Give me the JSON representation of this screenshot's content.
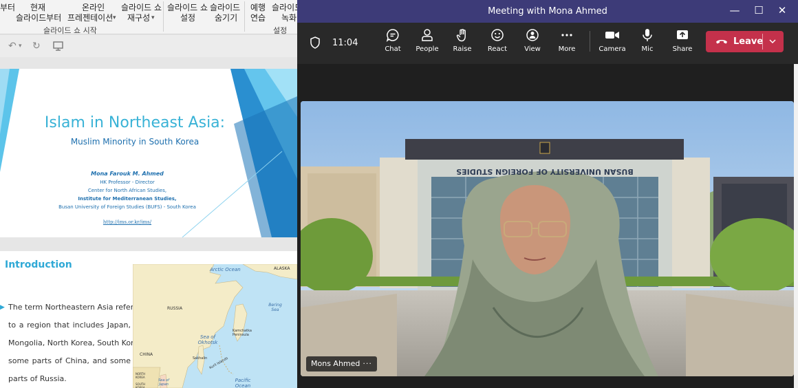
{
  "ppt": {
    "ribbon": {
      "btn_from_beginning_partial": "부터",
      "btn_current_line1": "현재",
      "btn_current_line2": "슬라이드부터",
      "btn_online_line1": "온라인",
      "btn_online_line2": "프레젠테이션",
      "btn_custom_line1": "슬라이드 쇼",
      "btn_custom_line2": "재구성",
      "group_start": "슬라이드 쇼 시작",
      "btn_setup_line1": "슬라이드 쇼",
      "btn_setup_line2": "설정",
      "btn_hide_line1": "슬라이드",
      "btn_hide_line2": "숨기기",
      "btn_rehearse_line1": "예행",
      "btn_rehearse_line2": "연습",
      "btn_record_line1": "슬라이드",
      "btn_record_line2": "녹화",
      "group_setup": "설정"
    },
    "slide1": {
      "title": "Islam in Northeast Asia:",
      "subtitle": "Muslim Minority in South Korea",
      "author": "Mona Farouk M. Ahmed",
      "line1": "HK Professor - Director",
      "line2": "Center for North African Studies,",
      "line3": "Institute for Mediterranean Studies,",
      "line4": "Busan University of Foreign Studies (BUFS) - South Korea",
      "link": "http://ims.or.kr/ims/"
    },
    "slide2": {
      "title": "Introduction",
      "bullet_lines": [
        "The term Northeastern Asia refers",
        "to a region that includes Japan,",
        "Mongolia, North Korea, South Korea,",
        "some parts of China, and some",
        "parts of Russia."
      ],
      "map": {
        "arctic": "Arctic Ocean",
        "alaska": "ALASKA",
        "russia": "RUSSIA",
        "bering": "Bering Sea",
        "okhotsk": "Sea of Okhotsk",
        "kamchatka": "Kamchatka Peninsula",
        "sakhalin": "Sakhalin",
        "kuril": "Kuril Islands",
        "china": "CHINA",
        "north_korea": "NORTH KOREA",
        "south_korea": "SOUTH KOREA",
        "sea_japan": "Sea of Japan",
        "pacific": "Pacific Ocean"
      }
    }
  },
  "teams": {
    "window_title": "Meeting with Mona Ahmed",
    "timer": "11:04",
    "controls": {
      "chat": "Chat",
      "people": "People",
      "raise": "Raise",
      "react": "React",
      "view": "View",
      "more": "More",
      "camera": "Camera",
      "mic": "Mic",
      "share": "Share"
    },
    "leave": "Leave",
    "video": {
      "building_sign": "BUSAN UNIVERSITY OF FOREIGN STUDIES",
      "participant_name": "Mons Ahmed",
      "name_more": "···"
    },
    "colors": {
      "titlebar": "#3d3b78",
      "toolbar": "#292929",
      "leave": "#c4314b",
      "slide_accent": "#38b2d6"
    }
  }
}
